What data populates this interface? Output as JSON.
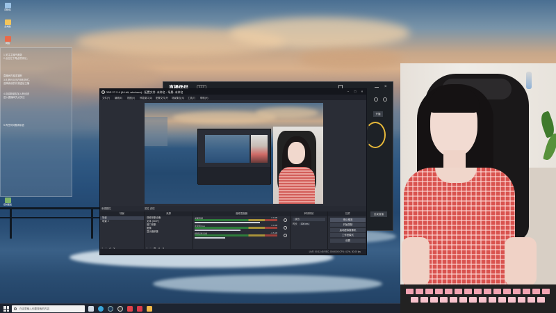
{
  "desktop": {
    "icons": [
      {
        "label": "回收站",
        "icon": "recycle-bin-icon",
        "color": "#9cc3e6"
      },
      {
        "label": "此电脑",
        "icon": "computer-icon",
        "color": "#f2c55c"
      },
      {
        "label": "网络",
        "icon": "network-icon",
        "color": "#e86a4a"
      },
      {
        "label": "控制面板",
        "icon": "control-panel-icon",
        "color": "#7fb36b"
      }
    ],
    "note_window": {
      "lines": [
        "1.关注主播不迷路",
        "2.点击左下角点赞评论，",
        "直播间内抽奖福利",
        "3.礼物可点击右侧礼物栏，",
        "选择喜欢的礼物送给主播",
        "4.欢迎新朋友加入粉丝团",
        "进入直播间先点关注",
        "5.有任何问题请私信"
      ]
    }
  },
  "helper_window": {
    "title": "直播伴侣",
    "tag": "3.3.0",
    "side_button": "开播",
    "bottom_button": "结束直播"
  },
  "obs": {
    "title": "OBS 27.2.4 (64-bit, windows) - 配置文件: 未命名 - 场景: 未命名",
    "menu": [
      "文件(F)",
      "编辑(E)",
      "视图(V)",
      "停靠窗口(D)",
      "配置文件(P)",
      "场景集合(S)",
      "工具(T)",
      "帮助(H)"
    ],
    "dock_tab": "来源属性",
    "preview_toolbar": "属性  滤镜",
    "scenes": {
      "title": "场景",
      "items": [
        "场景",
        "场景 2"
      ],
      "selected": 0
    },
    "sources": {
      "title": "来源",
      "items": [
        "视频采集设备",
        "文本 (GDI+)",
        "窗口采集",
        "图像",
        "显示器采集"
      ]
    },
    "mixer": {
      "title": "音频混音器",
      "tracks": [
        {
          "name": "桌面音频",
          "level": "0.0 dB",
          "volume": 0.85
        },
        {
          "name": "麦克风/Aux",
          "level": "0.0 dB",
          "volume": 0.6
        },
        {
          "name": "视频采集设备",
          "level": "-3.5 dB",
          "volume": 0.4
        }
      ]
    },
    "transitions": {
      "title": "转场特效",
      "type": "淡出",
      "duration_label": "时长",
      "duration": "300 ms"
    },
    "controls": {
      "title": "控件",
      "buttons": [
        "停止推流",
        "开始录制",
        "启动虚拟摄像机",
        "工作室模式",
        "设置",
        "退出"
      ],
      "active": 0
    },
    "status": "LIVE: 00:12:45   REC: 00:00:00   CPU: 4.2%, 30.00 fps"
  },
  "taskbar": {
    "search_placeholder": "在这里输入你要搜索的内容",
    "icons": [
      {
        "name": "task-view-icon",
        "color": "#cfd8e3"
      },
      {
        "name": "edge-icon",
        "color": "#3aa5d8"
      },
      {
        "name": "steam-icon",
        "color": "#1f3a5a"
      },
      {
        "name": "obs-icon",
        "color": "#3c3c3c"
      },
      {
        "name": "live-helper-icon",
        "color": "#e0434b"
      },
      {
        "name": "app-icon",
        "color": "#d93b4a"
      },
      {
        "name": "file-explorer-icon",
        "color": "#f3b94a"
      }
    ]
  }
}
